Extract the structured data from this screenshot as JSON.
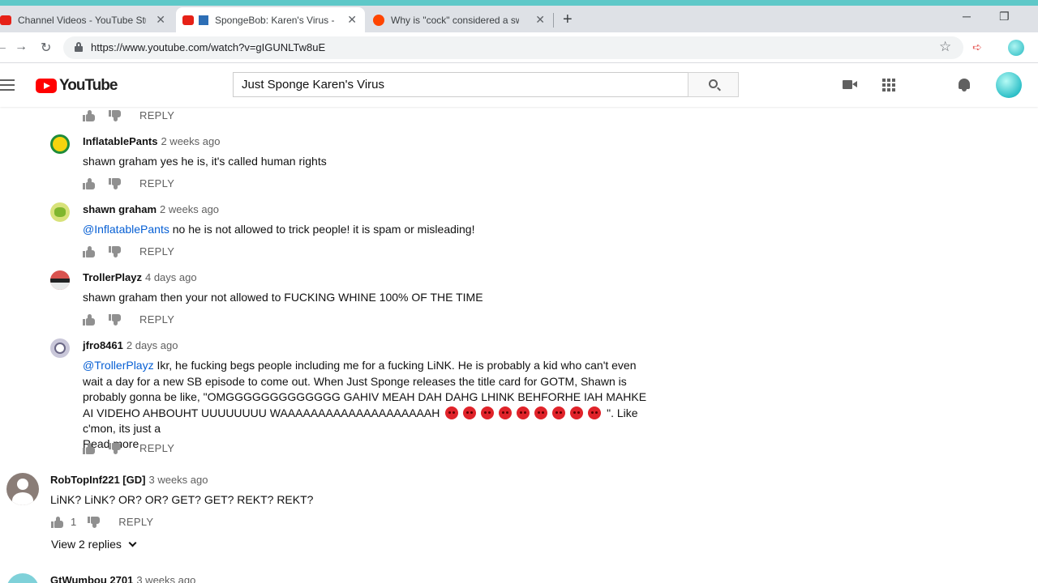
{
  "browser": {
    "tabs": [
      {
        "label": "Channel Videos - YouTube Studio",
        "active": false
      },
      {
        "label": "SpongeBob: Karen's Virus - The Movie",
        "active": true
      },
      {
        "label": "Why is \"cock\" considered a swear word?",
        "active": false
      }
    ],
    "new_tab": "+",
    "url": "https://www.youtube.com/watch?v=gIGUNLTw8uE",
    "minimize": "─",
    "restore": "❐",
    "close": "✕"
  },
  "youtube": {
    "logo_text": "YouTube",
    "search_query": "Just Sponge Karen's Virus"
  },
  "comments": {
    "reply_label": "REPLY",
    "read_more": "Read more",
    "items": [
      {
        "author": "InflatablePants",
        "time": "2 weeks ago",
        "mention": "",
        "text": "shawn graham yes he is, it's called human rights"
      },
      {
        "author": "shawn graham",
        "time": "2 weeks ago",
        "mention": "@InflatablePants",
        "text": " no he is not allowed to trick people! it is spam or misleading!"
      },
      {
        "author": "TrollerPlayz",
        "time": "4 days ago",
        "mention": "",
        "text": "shawn graham then your not allowed to FUCKING WHINE 100% OF THE TIME"
      },
      {
        "author": "jfro8461",
        "time": "2 days ago",
        "mention": "@TrollerPlayz",
        "text": " Ikr, he fucking begs people including me for a fucking LiNK. He is probably a kid who can't even wait a day for a new SB episode to come out. When Just Sponge releases the title card for GOTM, Shawn is probably gonna be like, \"OMGGGGGGGGGGGGG GAHIV MEAH DAH DAHG LHINK BEHFORHE IAH MAHKE AI VIDEHO AHBOUHT UUUUUUUU WAAAAAAAAAAAAAAAAAAAAH ",
        "text_end": " \". Like c'mon, its just a"
      },
      {
        "author": "RobTopInf221 [GD]",
        "time": "3 weeks ago",
        "mention": "",
        "text": "LiNK? LiNK? OR? OR? GET? GET? REKT? REKT?",
        "likes": "1"
      },
      {
        "author": "GtWumbou 2701",
        "time": "3 weeks ago"
      }
    ],
    "view_replies": "View 2 replies"
  }
}
